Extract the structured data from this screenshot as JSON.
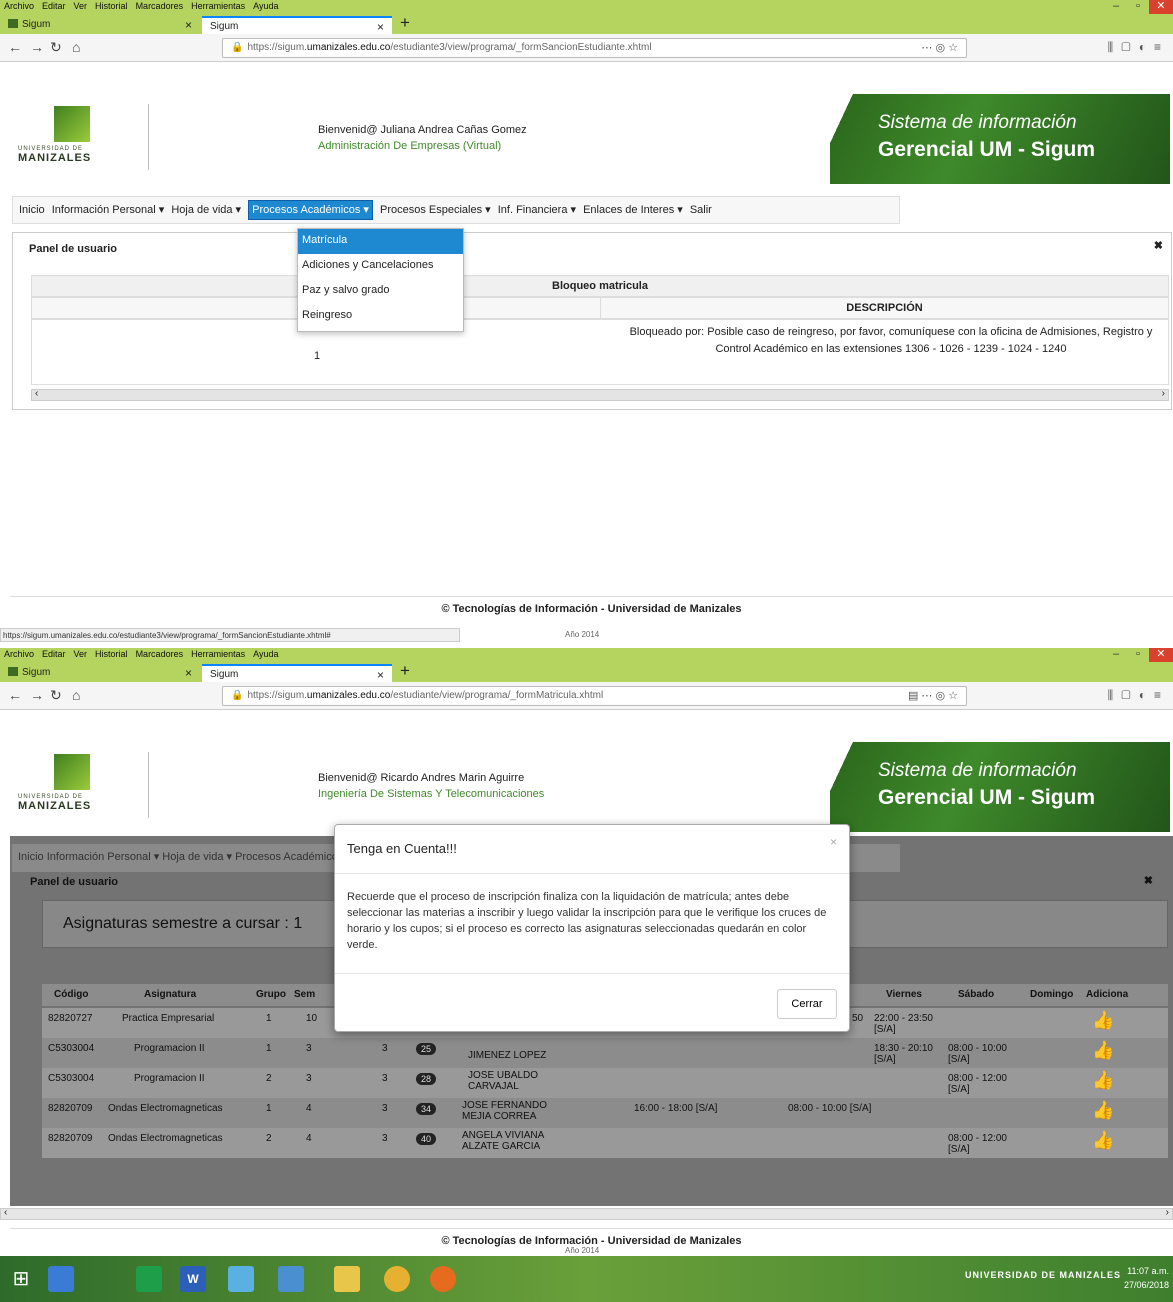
{
  "shot1": {
    "menu": [
      "Archivo",
      "Editar",
      "Ver",
      "Historial",
      "Marcadores",
      "Herramientas",
      "Ayuda"
    ],
    "tabs": [
      "Sigum",
      "Sigum"
    ],
    "url_prefix": "https://sigum.",
    "url_domain": "umanizales.edu.co",
    "url_path": "/estudiante3/view/programa/_formSancionEstudiante.xhtml",
    "welcome": "Bienvenid@ Juliana Andrea Cañas Gomez",
    "program": "Administración De Empresas (Virtual)",
    "logo_top": "UNIVERSIDAD DE",
    "logo_bottom": "MANIZALES",
    "banner_line1": "Sistema de información",
    "banner_line2": "Gerencial UM - Sigum",
    "nav": [
      "Inicio",
      "Información Personal ▾",
      "Hoja de vida ▾",
      "Procesos Académicos ▾",
      "Procesos Especiales ▾",
      "Inf. Financiera ▾",
      "Enlaces de Interes ▾",
      "Salir"
    ],
    "dropdown": [
      "Matrícula",
      "Adiciones y Cancelaciones",
      "Paz y salvo grado",
      "Reingreso"
    ],
    "panel_title": "Panel de usuario",
    "table_title": "Bloqueo matricula",
    "col_desc": "DESCRIPCIÓN",
    "row_num": "1",
    "row_desc": "Bloqueado por: Posible caso de reingreso, por favor, comuníquese con la oficina de Admisiones, Registro y Control Académico en las extensiones 1306 - 1026 - 1239 - 1024 - 1240",
    "footer": "© Tecnologías de Información - Universidad de Manizales",
    "status_url": "https://sigum.umanizales.edu.co/estudiante3/view/programa/_formSancionEstudiante.xhtml#",
    "year": "Año 2014"
  },
  "shot2": {
    "menu": [
      "Archivo",
      "Editar",
      "Ver",
      "Historial",
      "Marcadores",
      "Herramientas",
      "Ayuda"
    ],
    "tabs": [
      "Sigum",
      "Sigum"
    ],
    "url_prefix": "https://sigum.",
    "url_domain": "umanizales.edu.co",
    "url_path": "/estudiante/view/programa/_formMatricula.xhtml",
    "welcome": "Bienvenid@ Ricardo Andres Marin Aguirre",
    "program": "Ingeniería De Sistemas Y Telecomunicaciones",
    "logo_top": "UNIVERSIDAD DE",
    "logo_bottom": "MANIZALES",
    "banner_line1": "Sistema de información",
    "banner_line2": "Gerencial UM - Sigum",
    "nav_text": "Inicio  Información Personal ▾  Hoja de vida ▾  Procesos Académicos ▾  Procesos Especiales ▾  Inf. Financiera ▾  Enlaces de Interes ▾  Salir",
    "panel_title": "Panel de usuario",
    "asignaturas": "Asignaturas semestre a cursar : 1",
    "columns": [
      "Código",
      "Asignatura",
      "Grupo",
      "Sem",
      "Viernes",
      "Sábado",
      "Domingo",
      "Adiciona"
    ],
    "rows": [
      {
        "codigo": "82820727",
        "asignatura": "Practica Empresarial",
        "grupo": "1",
        "sem": "10",
        "cred": "",
        "badge": "",
        "docente": "",
        "martes": "",
        "jueves": "50",
        "viernes": "22:00 - 23:50 [S/A]",
        "sabado": ""
      },
      {
        "codigo": "C5303004",
        "asignatura": "Programacion II",
        "grupo": "1",
        "sem": "3",
        "cred": "3",
        "badge": "25",
        "docente": "JIMENEZ LOPEZ",
        "martes": "",
        "jueves": "",
        "viernes": "18:30 - 20:10 [S/A]",
        "sabado": "08:00 - 10:00 [S/A]"
      },
      {
        "codigo": "C5303004",
        "asignatura": "Programacion II",
        "grupo": "2",
        "sem": "3",
        "cred": "3",
        "badge": "28",
        "docente": "JOSE UBALDO CARVAJAL",
        "martes": "",
        "jueves": "",
        "viernes": "",
        "sabado": "08:00 - 12:00 [S/A]"
      },
      {
        "codigo": "82820709",
        "asignatura": "Ondas Electromagneticas",
        "grupo": "1",
        "sem": "4",
        "cred": "3",
        "badge": "34",
        "docente": "JOSE FERNANDO MEJIA CORREA",
        "martes": "16:00 - 18:00 [S/A]",
        "jueves": "08:00 - 10:00 [S/A]",
        "viernes": "",
        "sabado": ""
      },
      {
        "codigo": "82820709",
        "asignatura": "Ondas Electromagneticas",
        "grupo": "2",
        "sem": "4",
        "cred": "3",
        "badge": "40",
        "docente": "ANGELA VIVIANA ALZATE GARCIA",
        "martes": "",
        "jueves": "",
        "viernes": "",
        "sabado": "08:00 - 12:00 [S/A]"
      }
    ],
    "modal_title": "Tenga en Cuenta!!!",
    "modal_close_x": "×",
    "modal_body": "Recuerde que el proceso de inscripción finaliza con la liquidación de matrícula; antes debe seleccionar las materias a inscribir y luego validar la inscripción para que le verifique los cruces de horario y los cupos; si el proceso es correcto las asignaturas seleccionadas quedarán en color verde.",
    "modal_button": "Cerrar",
    "footer": "© Tecnologías de Información - Universidad de Manizales",
    "year": "Año 2014"
  },
  "taskbar": {
    "tray_text": "UNIVERSIDAD DE MANIZALES",
    "time": "11:07 a.m.",
    "date": "27/06/2018"
  }
}
